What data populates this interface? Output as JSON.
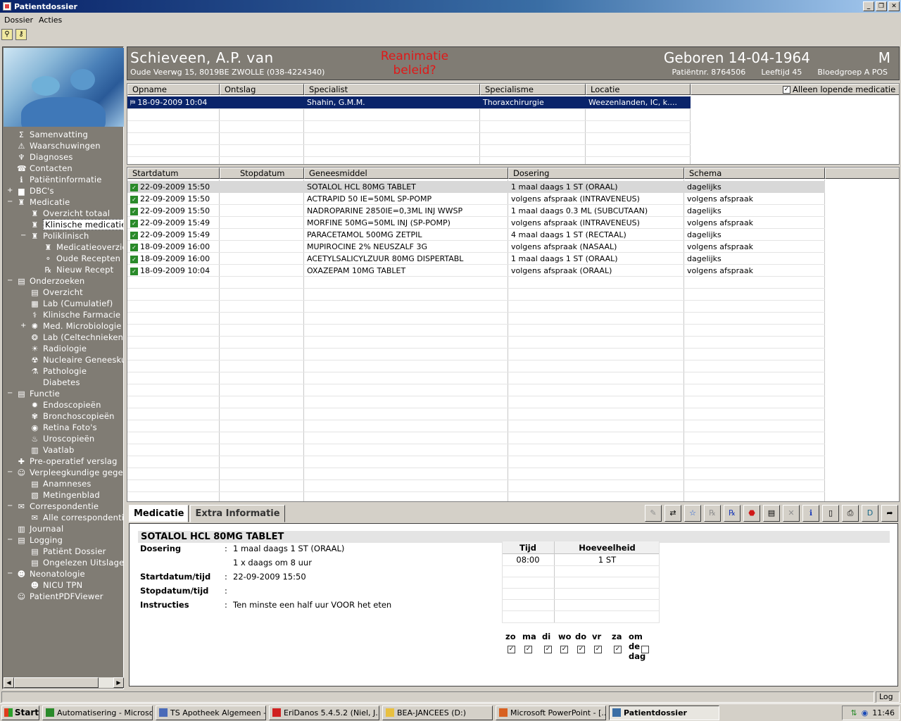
{
  "window": {
    "title": "Patientdossier"
  },
  "menu": [
    "Dossier",
    "Acties"
  ],
  "patient": {
    "name": "Schieveen, A.P. van",
    "address": "Oude Veerwg 15,  8019BE  ZWOLLE  (038-4224340)",
    "alert_line1": "Reanimatie",
    "alert_line2": "beleid?",
    "born": "Geboren 14-04-1964",
    "sex": "M",
    "patient_nr": "Patiëntnr. 8764506",
    "age": "Leeftijd 45",
    "blood": "Bloedgroep A POS"
  },
  "tree": [
    {
      "label": "Samenvatting",
      "icon": "sigma-icon",
      "glyph": "Σ",
      "indent": 0,
      "exp": ""
    },
    {
      "label": "Waarschuwingen",
      "icon": "warning-icon",
      "glyph": "⚠",
      "indent": 0,
      "exp": ""
    },
    {
      "label": "Diagnoses",
      "icon": "stethoscope-icon",
      "glyph": "♆",
      "indent": 0,
      "exp": ""
    },
    {
      "label": "Contacten",
      "icon": "contacts-icon",
      "glyph": "☎",
      "indent": 0,
      "exp": ""
    },
    {
      "label": "Patiëntinformatie",
      "icon": "info-icon",
      "glyph": "ℹ",
      "indent": 0,
      "exp": ""
    },
    {
      "label": "DBC's",
      "icon": "folder-icon",
      "glyph": "▆",
      "indent": 0,
      "exp": "+"
    },
    {
      "label": "Medicatie",
      "icon": "mortar-icon",
      "glyph": "♜",
      "indent": 0,
      "exp": "−"
    },
    {
      "label": "Overzicht totaal",
      "icon": "mortar-icon",
      "glyph": "♜",
      "indent": 1,
      "exp": ""
    },
    {
      "label": "Klinische medicatie",
      "icon": "mortar-icon",
      "glyph": "♜",
      "indent": 1,
      "exp": "",
      "selected": true
    },
    {
      "label": "Poliklinisch",
      "icon": "mortar-icon",
      "glyph": "♜",
      "indent": 1,
      "exp": "−"
    },
    {
      "label": "Medicatieoverzicht",
      "icon": "mortar-icon",
      "glyph": "♜",
      "indent": 2,
      "exp": ""
    },
    {
      "label": "Oude Recepten",
      "icon": "pills-icon",
      "glyph": "⚬",
      "indent": 2,
      "exp": ""
    },
    {
      "label": "Nieuw Recept",
      "icon": "rx-icon",
      "glyph": "℞",
      "indent": 2,
      "exp": ""
    },
    {
      "label": "Onderzoeken",
      "icon": "document-icon",
      "glyph": "▤",
      "indent": 0,
      "exp": "−"
    },
    {
      "label": "Overzicht",
      "icon": "document-icon",
      "glyph": "▤",
      "indent": 1,
      "exp": ""
    },
    {
      "label": "Lab (Cumulatief)",
      "icon": "lab-icon",
      "glyph": "▦",
      "indent": 1,
      "exp": ""
    },
    {
      "label": "Klinische Farmacie",
      "icon": "pharmacy-icon",
      "glyph": "⚕",
      "indent": 1,
      "exp": ""
    },
    {
      "label": "Med. Microbiologie",
      "icon": "microbe-icon",
      "glyph": "✺",
      "indent": 1,
      "exp": "+"
    },
    {
      "label": "Lab (Celtechnieken)",
      "icon": "cell-icon",
      "glyph": "❂",
      "indent": 1,
      "exp": ""
    },
    {
      "label": "Radiologie",
      "icon": "xray-icon",
      "glyph": "☀",
      "indent": 1,
      "exp": ""
    },
    {
      "label": "Nucleaire Geneeskunde",
      "icon": "radiation-icon",
      "glyph": "☢",
      "indent": 1,
      "exp": ""
    },
    {
      "label": "Pathologie",
      "icon": "microscope-icon",
      "glyph": "⚗",
      "indent": 1,
      "exp": ""
    },
    {
      "label": "Diabetes",
      "icon": "blank-icon",
      "glyph": "",
      "indent": 1,
      "exp": ""
    },
    {
      "label": "Functie",
      "icon": "document-icon",
      "glyph": "▤",
      "indent": 0,
      "exp": "−"
    },
    {
      "label": "Endoscopieën",
      "icon": "endoscopy-icon",
      "glyph": "✹",
      "indent": 1,
      "exp": ""
    },
    {
      "label": "Bronchoscopieën",
      "icon": "lungs-icon",
      "glyph": "✾",
      "indent": 1,
      "exp": ""
    },
    {
      "label": "Retina Foto's",
      "icon": "eye-icon",
      "glyph": "◉",
      "indent": 1,
      "exp": ""
    },
    {
      "label": "Uroscopieën",
      "icon": "kidney-icon",
      "glyph": "♨",
      "indent": 1,
      "exp": ""
    },
    {
      "label": "Vaatlab",
      "icon": "book-icon",
      "glyph": "▥",
      "indent": 1,
      "exp": ""
    },
    {
      "label": "Pre-operatief verslag",
      "icon": "cross-icon",
      "glyph": "✚",
      "indent": 0,
      "exp": ""
    },
    {
      "label": "Verpleegkundige gegevens",
      "icon": "nurse-icon",
      "glyph": "☺",
      "indent": 0,
      "exp": "−"
    },
    {
      "label": "Anamneses",
      "icon": "form-icon",
      "glyph": "▤",
      "indent": 1,
      "exp": ""
    },
    {
      "label": "Metingenblad",
      "icon": "chart-icon",
      "glyph": "▧",
      "indent": 1,
      "exp": ""
    },
    {
      "label": "Correspondentie",
      "icon": "letter-icon",
      "glyph": "✉",
      "indent": 0,
      "exp": "−"
    },
    {
      "label": "Alle correspondentie",
      "icon": "letter-icon",
      "glyph": "✉",
      "indent": 1,
      "exp": ""
    },
    {
      "label": "Journaal",
      "icon": "journal-icon",
      "glyph": "▥",
      "indent": 0,
      "exp": ""
    },
    {
      "label": "Logging",
      "icon": "document-icon",
      "glyph": "▤",
      "indent": 0,
      "exp": "−"
    },
    {
      "label": "Patiënt Dossier",
      "icon": "log-icon",
      "glyph": "▤",
      "indent": 1,
      "exp": ""
    },
    {
      "label": "Ongelezen Uitslagen",
      "icon": "log-icon",
      "glyph": "▤",
      "indent": 1,
      "exp": ""
    },
    {
      "label": "Neonatologie",
      "icon": "baby-icon",
      "glyph": "☻",
      "indent": 0,
      "exp": "−"
    },
    {
      "label": "NICU TPN",
      "icon": "baby-icon",
      "glyph": "☻",
      "indent": 1,
      "exp": ""
    },
    {
      "label": "PatientPDFViewer",
      "icon": "user-icon",
      "glyph": "☺",
      "indent": 0,
      "exp": ""
    }
  ],
  "admissions": {
    "headers": [
      "Opname",
      "Ontslag",
      "Specialist",
      "Specialisme",
      "Locatie"
    ],
    "only_running_label": "Alleen lopende medicatie",
    "only_running_checked": true,
    "rows": [
      [
        "18-09-2009 10:04",
        "",
        "Shahin, G.M.M.",
        "Thoraxchirurgie",
        "Weezenlanden, IC, k...."
      ]
    ]
  },
  "medications": {
    "headers": [
      "Startdatum",
      "Stopdatum",
      "Geneesmiddel",
      "Dosering",
      "Schema"
    ],
    "rows": [
      [
        "22-09-2009 15:50",
        "",
        "SOTALOL HCL 80MG TABLET",
        "1 maal daags 1 ST (ORAAL)",
        "dagelijks"
      ],
      [
        "22-09-2009 15:50",
        "",
        "ACTRAPID 50 IE=50ML SP-POMP",
        "volgens afspraak  (INTRAVENEUS)",
        "volgens afspraak"
      ],
      [
        "22-09-2009 15:50",
        "",
        "NADROPARINE 2850IE=0,3ML INJ WWSP",
        "1 maal daags 0.3 ML (SUBCUTAAN)",
        "dagelijks"
      ],
      [
        "22-09-2009 15:49",
        "",
        "MORFINE 50MG=50ML INJ (SP-POMP)",
        "volgens afspraak  (INTRAVENEUS)",
        "volgens afspraak"
      ],
      [
        "22-09-2009 15:49",
        "",
        "PARACETAMOL 500MG ZETPIL",
        "4 maal daags 1 ST (RECTAAL)",
        "dagelijks"
      ],
      [
        "18-09-2009 16:00",
        "",
        "MUPIROCINE 2% NEUSZALF 3G",
        "volgens afspraak  (NASAAL)",
        "volgens afspraak"
      ],
      [
        "18-09-2009 16:00",
        "",
        "ACETYLSALICYLZUUR 80MG DISPERTABL",
        "1 maal daags 1 ST (ORAAL)",
        "dagelijks"
      ],
      [
        "18-09-2009 10:04",
        "",
        "OXAZEPAM 10MG TABLET",
        "volgens afspraak  (ORAAL)",
        "volgens afspraak"
      ]
    ]
  },
  "tabs": [
    "Medicatie",
    "Extra Informatie"
  ],
  "bottom_toolbar": [
    {
      "name": "edit-icon",
      "glyph": "✎"
    },
    {
      "name": "swap-icon",
      "glyph": "⇄"
    },
    {
      "name": "star-icon",
      "glyph": "☆"
    },
    {
      "name": "rx-gray-icon",
      "glyph": "℞"
    },
    {
      "name": "rx-blue-icon",
      "glyph": "℞"
    },
    {
      "name": "stop-icon",
      "glyph": "⬣"
    },
    {
      "name": "clipboard-icon",
      "glyph": "▤"
    },
    {
      "name": "delete-icon",
      "glyph": "✕"
    },
    {
      "name": "info-icon",
      "glyph": "ℹ"
    },
    {
      "name": "new-document-icon",
      "glyph": "▯"
    },
    {
      "name": "print-icon",
      "glyph": "⎙"
    },
    {
      "name": "d-document-icon",
      "glyph": "D"
    },
    {
      "name": "export-icon",
      "glyph": "➦"
    }
  ],
  "detail": {
    "title": "SOTALOL HCL 80MG TABLET",
    "dosering_label": "Dosering",
    "dosering_value": "1 maal daags 1 ST (ORAAL)",
    "dosering_value2": "1 x daags om 8 uur",
    "start_label": "Startdatum/tijd",
    "start_value": "22-09-2009 15:50",
    "stop_label": "Stopdatum/tijd",
    "stop_value": "",
    "instr_label": "Instructies",
    "instr_value": "Ten minste een half uur VOOR het eten",
    "time_header": "Tijd",
    "qty_header": "Hoeveelheid",
    "time_value": "08:00",
    "qty_value": "1 ST",
    "days": [
      {
        "label": "zo",
        "checked": true
      },
      {
        "label": "ma",
        "checked": true
      },
      {
        "label": "di",
        "checked": true
      },
      {
        "label": "wo",
        "checked": true
      },
      {
        "label": "do",
        "checked": true
      },
      {
        "label": "vr",
        "checked": true
      },
      {
        "label": "za",
        "checked": true
      },
      {
        "label": "om de dag",
        "checked": false
      }
    ]
  },
  "status": {
    "right": "Log"
  },
  "taskbar": {
    "start": "Start",
    "tasks": [
      "Automatisering - Microso...",
      "TS Apotheek Algemeen -...",
      "EriDanos 5.4.5.2 (Niel, J...",
      "BEA-JANCEES (D:)",
      "Microsoft PowerPoint - [...",
      "Patientdossier"
    ],
    "clock": "11:46"
  }
}
